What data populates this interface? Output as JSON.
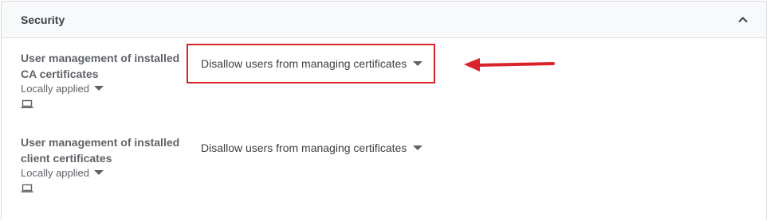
{
  "section": {
    "title": "Security"
  },
  "settings": [
    {
      "label": "User management of installed CA certificates",
      "scope": "Locally applied",
      "value": "Disallow users from managing certificates"
    },
    {
      "label": "User management of installed client certificates",
      "scope": "Locally applied",
      "value": "Disallow users from managing certificates"
    }
  ],
  "colors": {
    "annotation": "#d9232a",
    "header_bg": "#f8f9fa",
    "text": "#3c4043",
    "muted": "#5f6368"
  },
  "icons": {
    "collapse": "chevron-up-icon",
    "device": "laptop-icon",
    "dropdown": "caret-down-icon",
    "annotation": "arrow-left-icon"
  }
}
